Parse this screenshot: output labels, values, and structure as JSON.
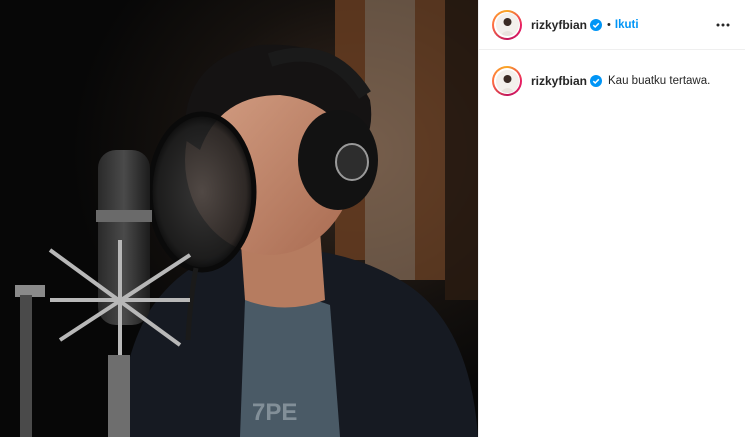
{
  "post": {
    "author": {
      "username": "rizkyfbian",
      "verified": true,
      "follow_label": "Ikuti",
      "separator": "•"
    },
    "caption": {
      "username": "rizkyfbian",
      "text": "Kau buatku tertawa."
    },
    "icons": {
      "verified": "verified-badge-icon",
      "more": "more-options-icon"
    },
    "colors": {
      "link": "#0095f6",
      "verified_badge": "#0095f6",
      "text": "#262626",
      "border": "#efefef"
    }
  }
}
